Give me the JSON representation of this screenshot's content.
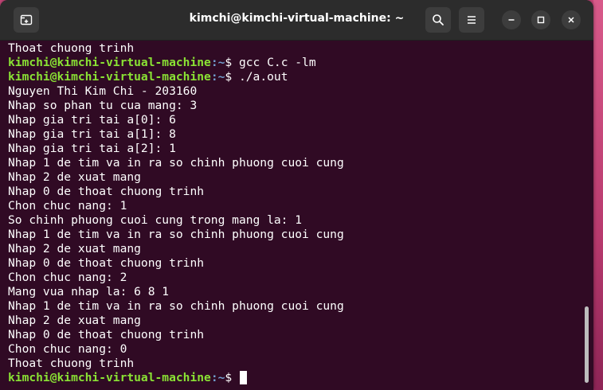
{
  "window": {
    "title": "kimchi@kimchi-virtual-machine: ~"
  },
  "prompt": {
    "user_host": "kimchi@kimchi-virtual-machine",
    "path": ":~",
    "symbol": "$"
  },
  "terminal": {
    "lines": [
      {
        "type": "output",
        "text": "Thoat chuong trinh"
      },
      {
        "type": "prompt",
        "command": " gcc C.c -lm"
      },
      {
        "type": "prompt",
        "command": " ./a.out"
      },
      {
        "type": "output",
        "text": "Nguyen Thi Kim Chi - 203160"
      },
      {
        "type": "output",
        "text": "Nhap so phan tu cua mang: 3"
      },
      {
        "type": "output",
        "text": "Nhap gia tri tai a[0]: 6"
      },
      {
        "type": "output",
        "text": "Nhap gia tri tai a[1]: 8"
      },
      {
        "type": "output",
        "text": "Nhap gia tri tai a[2]: 1"
      },
      {
        "type": "output",
        "text": "Nhap 1 de tim va in ra so chinh phuong cuoi cung"
      },
      {
        "type": "output",
        "text": "Nhap 2 de xuat mang"
      },
      {
        "type": "output",
        "text": "Nhap 0 de thoat chuong trinh"
      },
      {
        "type": "output",
        "text": "Chon chuc nang: 1"
      },
      {
        "type": "output",
        "text": "So chinh phuong cuoi cung trong mang la: 1"
      },
      {
        "type": "output",
        "text": "Nhap 1 de tim va in ra so chinh phuong cuoi cung"
      },
      {
        "type": "output",
        "text": "Nhap 2 de xuat mang"
      },
      {
        "type": "output",
        "text": "Nhap 0 de thoat chuong trinh"
      },
      {
        "type": "output",
        "text": "Chon chuc nang: 2"
      },
      {
        "type": "output",
        "text": "Mang vua nhap la: 6 8 1"
      },
      {
        "type": "output",
        "text": "Nhap 1 de tim va in ra so chinh phuong cuoi cung"
      },
      {
        "type": "output",
        "text": "Nhap 2 de xuat mang"
      },
      {
        "type": "output",
        "text": "Nhap 0 de thoat chuong trinh"
      },
      {
        "type": "output",
        "text": "Chon chuc nang: 0"
      },
      {
        "type": "output",
        "text": "Thoat chuong trinh"
      },
      {
        "type": "prompt",
        "command": " ",
        "cursor": true
      }
    ]
  },
  "icons": {
    "new_tab": "new-tab-icon",
    "search": "search-icon",
    "menu": "hamburger-menu-icon",
    "minimize": "minimize-icon",
    "maximize": "maximize-icon",
    "close": "close-icon"
  },
  "colors": {
    "background": "#300a24",
    "prompt_user": "#8ae234",
    "prompt_path": "#729fcf",
    "text": "#ffffff",
    "titlebar": "#2c2c2c"
  }
}
